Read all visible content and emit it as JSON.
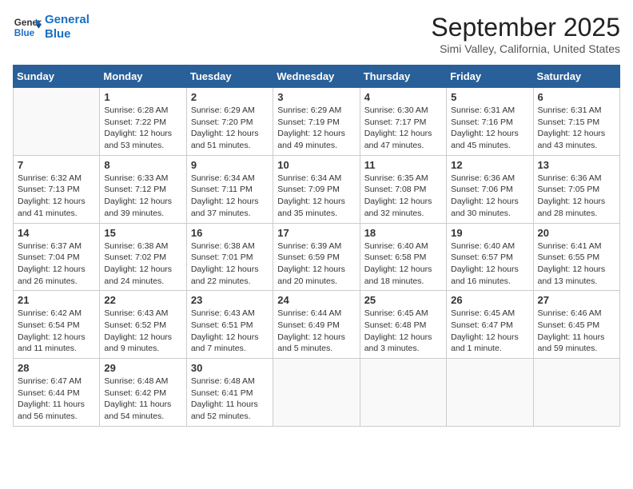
{
  "header": {
    "logo_line1": "General",
    "logo_line2": "Blue",
    "month": "September 2025",
    "location": "Simi Valley, California, United States"
  },
  "weekdays": [
    "Sunday",
    "Monday",
    "Tuesday",
    "Wednesday",
    "Thursday",
    "Friday",
    "Saturday"
  ],
  "weeks": [
    [
      {
        "day": "",
        "info": ""
      },
      {
        "day": "1",
        "info": "Sunrise: 6:28 AM\nSunset: 7:22 PM\nDaylight: 12 hours\nand 53 minutes."
      },
      {
        "day": "2",
        "info": "Sunrise: 6:29 AM\nSunset: 7:20 PM\nDaylight: 12 hours\nand 51 minutes."
      },
      {
        "day": "3",
        "info": "Sunrise: 6:29 AM\nSunset: 7:19 PM\nDaylight: 12 hours\nand 49 minutes."
      },
      {
        "day": "4",
        "info": "Sunrise: 6:30 AM\nSunset: 7:17 PM\nDaylight: 12 hours\nand 47 minutes."
      },
      {
        "day": "5",
        "info": "Sunrise: 6:31 AM\nSunset: 7:16 PM\nDaylight: 12 hours\nand 45 minutes."
      },
      {
        "day": "6",
        "info": "Sunrise: 6:31 AM\nSunset: 7:15 PM\nDaylight: 12 hours\nand 43 minutes."
      }
    ],
    [
      {
        "day": "7",
        "info": "Sunrise: 6:32 AM\nSunset: 7:13 PM\nDaylight: 12 hours\nand 41 minutes."
      },
      {
        "day": "8",
        "info": "Sunrise: 6:33 AM\nSunset: 7:12 PM\nDaylight: 12 hours\nand 39 minutes."
      },
      {
        "day": "9",
        "info": "Sunrise: 6:34 AM\nSunset: 7:11 PM\nDaylight: 12 hours\nand 37 minutes."
      },
      {
        "day": "10",
        "info": "Sunrise: 6:34 AM\nSunset: 7:09 PM\nDaylight: 12 hours\nand 35 minutes."
      },
      {
        "day": "11",
        "info": "Sunrise: 6:35 AM\nSunset: 7:08 PM\nDaylight: 12 hours\nand 32 minutes."
      },
      {
        "day": "12",
        "info": "Sunrise: 6:36 AM\nSunset: 7:06 PM\nDaylight: 12 hours\nand 30 minutes."
      },
      {
        "day": "13",
        "info": "Sunrise: 6:36 AM\nSunset: 7:05 PM\nDaylight: 12 hours\nand 28 minutes."
      }
    ],
    [
      {
        "day": "14",
        "info": "Sunrise: 6:37 AM\nSunset: 7:04 PM\nDaylight: 12 hours\nand 26 minutes."
      },
      {
        "day": "15",
        "info": "Sunrise: 6:38 AM\nSunset: 7:02 PM\nDaylight: 12 hours\nand 24 minutes."
      },
      {
        "day": "16",
        "info": "Sunrise: 6:38 AM\nSunset: 7:01 PM\nDaylight: 12 hours\nand 22 minutes."
      },
      {
        "day": "17",
        "info": "Sunrise: 6:39 AM\nSunset: 6:59 PM\nDaylight: 12 hours\nand 20 minutes."
      },
      {
        "day": "18",
        "info": "Sunrise: 6:40 AM\nSunset: 6:58 PM\nDaylight: 12 hours\nand 18 minutes."
      },
      {
        "day": "19",
        "info": "Sunrise: 6:40 AM\nSunset: 6:57 PM\nDaylight: 12 hours\nand 16 minutes."
      },
      {
        "day": "20",
        "info": "Sunrise: 6:41 AM\nSunset: 6:55 PM\nDaylight: 12 hours\nand 13 minutes."
      }
    ],
    [
      {
        "day": "21",
        "info": "Sunrise: 6:42 AM\nSunset: 6:54 PM\nDaylight: 12 hours\nand 11 minutes."
      },
      {
        "day": "22",
        "info": "Sunrise: 6:43 AM\nSunset: 6:52 PM\nDaylight: 12 hours\nand 9 minutes."
      },
      {
        "day": "23",
        "info": "Sunrise: 6:43 AM\nSunset: 6:51 PM\nDaylight: 12 hours\nand 7 minutes."
      },
      {
        "day": "24",
        "info": "Sunrise: 6:44 AM\nSunset: 6:49 PM\nDaylight: 12 hours\nand 5 minutes."
      },
      {
        "day": "25",
        "info": "Sunrise: 6:45 AM\nSunset: 6:48 PM\nDaylight: 12 hours\nand 3 minutes."
      },
      {
        "day": "26",
        "info": "Sunrise: 6:45 AM\nSunset: 6:47 PM\nDaylight: 12 hours\nand 1 minute."
      },
      {
        "day": "27",
        "info": "Sunrise: 6:46 AM\nSunset: 6:45 PM\nDaylight: 11 hours\nand 59 minutes."
      }
    ],
    [
      {
        "day": "28",
        "info": "Sunrise: 6:47 AM\nSunset: 6:44 PM\nDaylight: 11 hours\nand 56 minutes."
      },
      {
        "day": "29",
        "info": "Sunrise: 6:48 AM\nSunset: 6:42 PM\nDaylight: 11 hours\nand 54 minutes."
      },
      {
        "day": "30",
        "info": "Sunrise: 6:48 AM\nSunset: 6:41 PM\nDaylight: 11 hours\nand 52 minutes."
      },
      {
        "day": "",
        "info": ""
      },
      {
        "day": "",
        "info": ""
      },
      {
        "day": "",
        "info": ""
      },
      {
        "day": "",
        "info": ""
      }
    ]
  ]
}
